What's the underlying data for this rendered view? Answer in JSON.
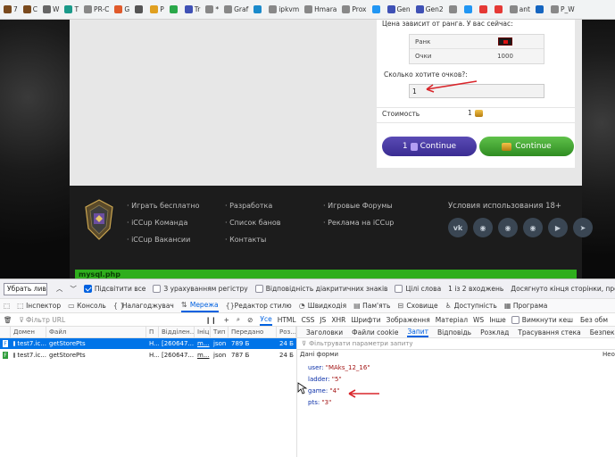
{
  "bookmarks": [
    {
      "label": "7",
      "color": "#7a4a1e"
    },
    {
      "label": "C",
      "color": "#7a4a1e"
    },
    {
      "label": "W",
      "color": "#666666"
    },
    {
      "label": "T",
      "color": "#1a9a8a"
    },
    {
      "label": "PR-C",
      "color": "#888888"
    },
    {
      "label": "G",
      "color": "#e05a2b"
    },
    {
      "label": "",
      "color": "#555555"
    },
    {
      "label": "P",
      "color": "#e0a020"
    },
    {
      "label": "",
      "color": "#2aa84a"
    },
    {
      "label": "Tr",
      "color": "#3f51b5"
    },
    {
      "label": "*",
      "color": "#888888"
    },
    {
      "label": "Graf",
      "color": "#888888"
    },
    {
      "label": "",
      "color": "#1a8acb"
    },
    {
      "label": "ipkvm",
      "color": "#888888"
    },
    {
      "label": "Hmara",
      "color": "#888888"
    },
    {
      "label": "Prox",
      "color": "#888888"
    },
    {
      "label": "",
      "color": "#2196f3"
    },
    {
      "label": "Gen",
      "color": "#3f51b5"
    },
    {
      "label": "Gen2",
      "color": "#3f51b5"
    },
    {
      "label": "",
      "color": "#888888"
    },
    {
      "label": "",
      "color": "#2196f3"
    },
    {
      "label": "",
      "color": "#e53935"
    },
    {
      "label": "",
      "color": "#e53935"
    },
    {
      "label": "ant",
      "color": "#888888"
    },
    {
      "label": "",
      "color": "#1565c0"
    },
    {
      "label": "P_W",
      "color": "#888888"
    }
  ],
  "form": {
    "rank_note": "Цена зависит от ранга. У вас сейчас:",
    "rank_label": "Ранк",
    "points_label": "Очки",
    "points_value": "1000",
    "question": "Сколько хотите очков?:",
    "input_value": "1",
    "cost_label": "Стоимость",
    "cost_value": "1",
    "btn_purple_count": "1",
    "btn_purple_label": "Continue",
    "btn_green_label": "Continue"
  },
  "footer": {
    "col1": [
      "· Играть бесплатно",
      "· iCCup Команда",
      "· iCCup Вакансии"
    ],
    "col2": [
      "· Разработка",
      "· Список банов",
      "· Контакты"
    ],
    "col3": [
      "· Игровые Форумы",
      "· Реклама на iCCup"
    ],
    "terms": "Условия использования 18+",
    "mysql": "mysql.php"
  },
  "find_bar": {
    "input_value": "Убрать лив",
    "highlight_all": "Підсвітити все",
    "match_case": "З урахуванням регістру",
    "diacritics": "Відповідність діакритичних знаків",
    "whole_words": "Цілі слова",
    "count": "1 із 2 входжень",
    "status": "Досягнуто кінця сторінки, продовжено від початку"
  },
  "devtools_tabs": [
    "Інспектор",
    "Консоль",
    "Налагоджувач",
    "Мережа",
    "Редактор стилю",
    "Швидкодія",
    "Пам'ять",
    "Сховище",
    "Доступність",
    "Програма"
  ],
  "devtools_selected_tab": "Мережа",
  "filter": {
    "placeholder": "Фільтр URL",
    "types": [
      "Усе",
      "HTML",
      "CSS",
      "JS",
      "XHR",
      "Шрифти",
      "Зображення",
      "Матеріал",
      "WS",
      "Інше"
    ],
    "disable_cache": "Вимкнути кеш",
    "no_throttle": "Без обм"
  },
  "columns": [
    "",
    "Домен",
    "Файл",
    "П",
    "Відділен...",
    "Ініц...",
    "Тип",
    "Передано",
    "Роз..."
  ],
  "requests": [
    {
      "status": "F",
      "domain": "test7.ic...",
      "file": "getStorePts",
      "method": "H...",
      "remote": "[260647...",
      "initiator": "m...",
      "type": "json",
      "transferred": "789 Б",
      "size": "24 Б",
      "selected": true
    },
    {
      "status": "F",
      "domain": "test7.ic...",
      "file": "getStorePts",
      "method": "H...",
      "remote": "[260647...",
      "initiator": "m...",
      "type": "json",
      "transferred": "787 Б",
      "size": "24 Б",
      "selected": false
    }
  ],
  "detail_tabs": [
    "Заголовки",
    "Файли cookie",
    "Запит",
    "Відповідь",
    "Розклад",
    "Трасування стека",
    "Безпека"
  ],
  "detail_selected": "Запит",
  "detail": {
    "filter_placeholder": "Фільтрувати параметри запиту",
    "form_data": "Дані форми",
    "right_label": "Необр",
    "params": [
      {
        "key": "user",
        "value": "\"MAks_12_16\""
      },
      {
        "key": "ladder",
        "value": "\"5\""
      },
      {
        "key": "game",
        "value": "\"4\""
      },
      {
        "key": "pts",
        "value": "\"3\""
      }
    ]
  },
  "colors": {
    "accent": "#0061e0",
    "selected_row": "#0074e8",
    "arrow": "#d9262b",
    "mysql_bar": "#2fae1d"
  }
}
